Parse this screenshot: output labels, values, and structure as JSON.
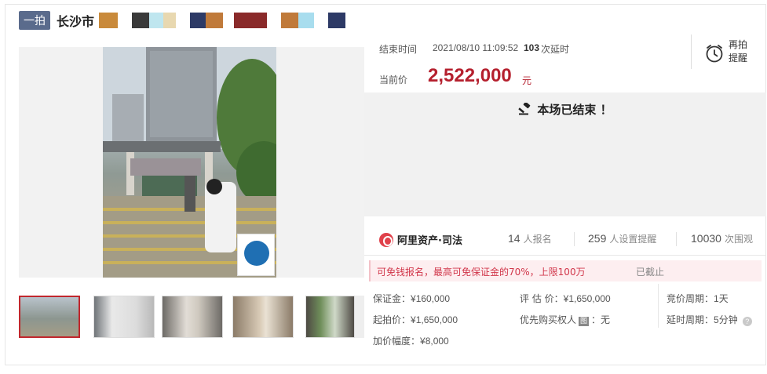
{
  "title": {
    "badge": "一拍",
    "city": "长沙市",
    "mosaic_colors": [
      "#c98a3b",
      "#ffffff",
      "#3a3a3a",
      "#bfe6ef",
      "#e8d8b0",
      "#ffffff",
      "#2d3a66",
      "#c07a3a",
      "#ffffff",
      "#8a2a2a",
      "#ffffff",
      "#c07a3a",
      "#a8ddee",
      "#ffffff",
      "#2d3a66"
    ]
  },
  "auction": {
    "end_label": "结束时间",
    "end_time": "2021/08/10 11:09:52",
    "delay_count": "103",
    "delay_text": "次延时",
    "price_label": "当前价",
    "price_value": "2,522,000",
    "price_unit": "元",
    "reminder_line1": "再拍",
    "reminder_line2": "提醒",
    "status_text": "本场已结束 ！"
  },
  "platform": {
    "logo_text": "阿里资产·司法",
    "signups_num": "14",
    "signups_label": "人报名",
    "reminders_num": "259",
    "reminders_label": "人设置提醒",
    "views_num": "10030",
    "views_label": "次围观"
  },
  "notice": {
    "text": "可免钱报名，最高可免保证金的70%，上限100万",
    "status": "已截止"
  },
  "details": {
    "deposit_label": "保证金：",
    "deposit_value": "¥160,000",
    "appraisal_label": "评 估 价：",
    "appraisal_value": "¥1,650,000",
    "cycle_label": "竞价周期：",
    "cycle_value": "1天",
    "start_label": "起拍价：",
    "start_value": "¥1,650,000",
    "priority_label": "优先购买权人",
    "priority_badge": "图",
    "priority_value": "：无",
    "delay_label": "延时周期：",
    "delay_value": "5分钟",
    "increment_label": "加价幅度：",
    "increment_value": "¥8,000"
  },
  "colors": {
    "accent_red": "#b5202e",
    "badge_bg": "#5a6b8c",
    "notice_bg": "#fdeef0"
  }
}
